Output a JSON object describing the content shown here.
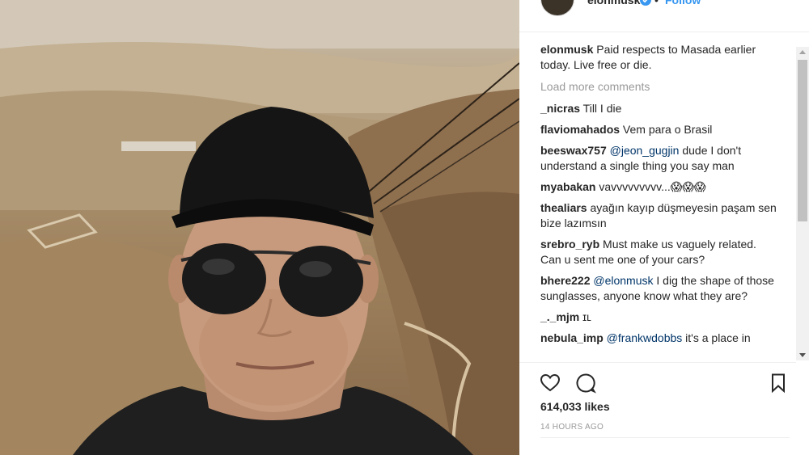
{
  "post": {
    "photo_alt": "Selfie of a man in a black cap and aviator sunglasses above desert canyon",
    "header": {
      "username": "elonmusk",
      "separator": "•",
      "follow_label": "Follow"
    },
    "caption": {
      "user": "elonmusk",
      "text": " Paid respects to Masada earlier today. Live free or die."
    },
    "load_more_label": "Load more comments",
    "comments": [
      {
        "user": "_nicras",
        "mention": "",
        "text": " Till I die"
      },
      {
        "user": "flaviomahados",
        "mention": "",
        "text": " Vem para o Brasil"
      },
      {
        "user": "beeswax757",
        "mention": " @jeon_gugjin",
        "text": " dude I don't understand a single thing you say man"
      },
      {
        "user": "myabakan",
        "mention": "",
        "text": " vavvvvvvvvv...😱😱😱"
      },
      {
        "user": "thealiars",
        "mention": "",
        "text": " ayağın kayıp düşmeyesin paşam sen bize lazımsın"
      },
      {
        "user": "srebro_ryb",
        "mention": "",
        "text": " Must make us vaguely related. Can u sent me one of your cars?"
      },
      {
        "user": "bhere222",
        "mention": " @elonmusk",
        "text": " I dig the shape of those sunglasses, anyone know what they are?"
      },
      {
        "user": "_._mjm",
        "mention": "",
        "text": " ɪʟ"
      },
      {
        "user": "nebula_imp",
        "mention": " @frankwdobbs",
        "text": " it's a place in"
      }
    ],
    "likes": "614,033 likes",
    "timestamp": "14 HOURS AGO",
    "icons": {
      "like": "heart-icon",
      "comment": "comment-bubble-icon",
      "save": "bookmark-icon",
      "verified": "verified-badge-icon"
    },
    "colors": {
      "link": "#3897f0",
      "mention": "#003569",
      "muted": "#999999",
      "text": "#262626"
    }
  }
}
